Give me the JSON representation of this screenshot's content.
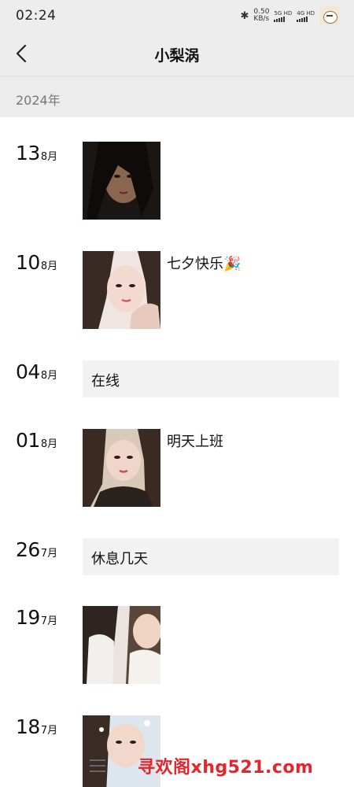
{
  "status_bar": {
    "time": "02:24",
    "speed_value": "0.50",
    "speed_unit": "KB/s",
    "network_1": "5G HD",
    "network_2": "4G HD",
    "icons": [
      "bluetooth-icon",
      "signal-icon",
      "avatar-icon"
    ]
  },
  "nav": {
    "back_icon": "chevron-left-icon",
    "title": "小梨涡"
  },
  "year_header": "2024年",
  "feed": [
    {
      "day": "13",
      "month": "8月",
      "type": "photo",
      "caption": ""
    },
    {
      "day": "10",
      "month": "8月",
      "type": "photo",
      "caption": "七夕快乐🎉"
    },
    {
      "day": "04",
      "month": "8月",
      "type": "text",
      "text": "在线"
    },
    {
      "day": "01",
      "month": "8月",
      "type": "photo",
      "caption": "明天上班"
    },
    {
      "day": "26",
      "month": "7月",
      "type": "text",
      "text": "休息几天"
    },
    {
      "day": "19",
      "month": "7月",
      "type": "photo",
      "caption": ""
    },
    {
      "day": "18",
      "month": "7月",
      "type": "photo",
      "caption": ""
    }
  ],
  "bottom": {
    "menu_icon": "hamburger-menu-icon",
    "watermark": "寻欢阁xhg521.com"
  },
  "colors": {
    "header_bg": "#ededed",
    "text_card_bg": "#f2f2f2",
    "watermark": "#e5242b"
  }
}
